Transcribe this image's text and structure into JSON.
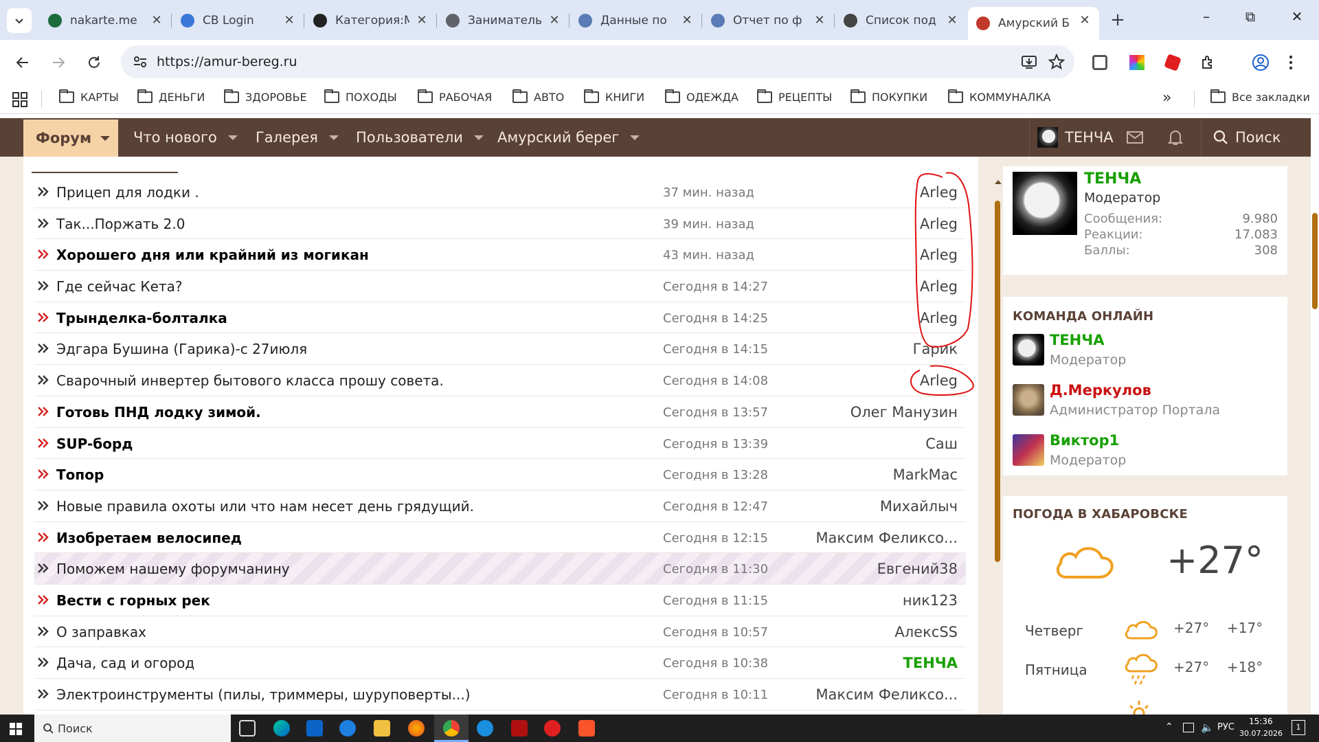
{
  "browser": {
    "tabs": [
      {
        "label": "nakarte.me",
        "icon": "nakarte-icon",
        "color": "#1b6b3a"
      },
      {
        "label": "CB Login",
        "icon": "cb-login-icon",
        "color": "#3b78d8"
      },
      {
        "label": "Категория:М",
        "icon": "category-icon",
        "color": "#222222"
      },
      {
        "label": "Заниматель",
        "icon": "globe-icon",
        "color": "#5f6368"
      },
      {
        "label": "Данные по",
        "icon": "emblem-icon",
        "color": "#5a7bb5"
      },
      {
        "label": "Отчет по ф",
        "icon": "emblem-icon",
        "color": "#5a7bb5"
      },
      {
        "label": "Список под",
        "icon": "bank-icon",
        "color": "#444444"
      },
      {
        "label": "Амурский Б",
        "icon": "amur-icon",
        "color": "#c0392b"
      }
    ],
    "url": "https://amur-bereg.ru",
    "bookmarks": [
      "КАРТЫ",
      "ДЕНЬГИ",
      "ЗДОРОВЬЕ",
      "ПОХОДЫ",
      "РАБОЧАЯ",
      "АВТО",
      "КНИГИ",
      "ОДЕЖДА",
      "РЕЦЕПТЫ",
      "ПОКУПКИ",
      "КОММУНАЛКА"
    ],
    "all_bookmarks": "Все закладки"
  },
  "nav": {
    "forum": "Форум",
    "items": [
      "Что нового",
      "Галерея",
      "Пользователи",
      "Амурский берег"
    ],
    "user": "ТЕНЧА",
    "search": "Поиск"
  },
  "threads": [
    {
      "title": "Прицеп для лодки .",
      "time": "37 мин. назад",
      "author": "Arleg",
      "bold": false
    },
    {
      "title": "Так...Поржать 2.0",
      "time": "39 мин. назад",
      "author": "Arleg",
      "bold": false
    },
    {
      "title": "Хорошего дня или крайний из могикан",
      "time": "43 мин. назад",
      "author": "Arleg",
      "bold": true
    },
    {
      "title": "Где сейчас Кета?",
      "time": "Сегодня в 14:27",
      "author": "Arleg",
      "bold": false
    },
    {
      "title": "Трынделка-болталка",
      "time": "Сегодня в 14:25",
      "author": "Arleg",
      "bold": true
    },
    {
      "title": "Эдгара Бушина (Гарика)-с 27июля",
      "time": "Сегодня в 14:15",
      "author": "Гарик",
      "bold": false
    },
    {
      "title": "Сварочный инвертер бытового класса прошу совета.",
      "time": "Сегодня в 14:08",
      "author": "Arleg",
      "bold": false
    },
    {
      "title": "Готовь ПНД лодку зимой.",
      "time": "Сегодня в 13:57",
      "author": "Олег Манузин",
      "bold": true
    },
    {
      "title": "SUP-борд",
      "time": "Сегодня в 13:39",
      "author": "Саш",
      "bold": true
    },
    {
      "title": "Топор",
      "time": "Сегодня в 13:28",
      "author": "MarkMac",
      "bold": true
    },
    {
      "title": "Новые правила охоты или что нам несет день грядущий.",
      "time": "Сегодня в 12:47",
      "author": "Михайлыч",
      "bold": false
    },
    {
      "title": "Изобретаем велосипед",
      "time": "Сегодня в 12:15",
      "author": "Максим Феликсо...",
      "bold": true
    },
    {
      "title": "Поможем нашему форумчанину",
      "time": "Сегодня в 11:30",
      "author": "Евгений38",
      "bold": false,
      "highlight": true
    },
    {
      "title": "Вести с горных рек",
      "time": "Сегодня в 11:15",
      "author": "ник123",
      "bold": true
    },
    {
      "title": "О заправках",
      "time": "Сегодня в 10:57",
      "author": "АлексSS",
      "bold": false
    },
    {
      "title": "Дача, сад и огород",
      "time": "Сегодня в 10:38",
      "author": "ТЕНЧА",
      "bold": false,
      "author_green": true
    },
    {
      "title": "Электроинструменты (пилы, триммеры, шуруповерты...)",
      "time": "Сегодня в 10:11",
      "author": "Максим Феликсо...",
      "bold": false
    }
  ],
  "profile": {
    "name": "ТЕНЧА",
    "role": "Модератор",
    "stats": [
      {
        "label": "Сообщения:",
        "value": "9.980"
      },
      {
        "label": "Реакции:",
        "value": "17.083"
      },
      {
        "label": "Баллы:",
        "value": "308"
      }
    ]
  },
  "team": {
    "heading": "КОМАНДА ОНЛАЙН",
    "members": [
      {
        "name": "ТЕНЧА",
        "role": "Модератор",
        "color": "#17a000"
      },
      {
        "name": "Д.Меркулов",
        "role": "Администратор Портала",
        "color": "#cc1111"
      },
      {
        "name": "Виктор1",
        "role": "Модератор",
        "color": "#17a000"
      }
    ]
  },
  "weather": {
    "heading": "ПОГОДА В ХАБАРОВСКЕ",
    "current": "+27°",
    "forecast": [
      {
        "day": "Четверг",
        "high": "+27°",
        "low": "+17°"
      },
      {
        "day": "Пятница",
        "high": "+27°",
        "low": "+18°"
      }
    ]
  },
  "taskbar": {
    "search": "Поиск",
    "lang": "РУС",
    "time": "15:36",
    "date": "30.07.2026",
    "notif": "1"
  },
  "colors": {
    "nav_bg": "#5a4136",
    "accent": "#f6d3a7",
    "unread_chevron": "#d42020",
    "read_chevron": "#333333"
  }
}
